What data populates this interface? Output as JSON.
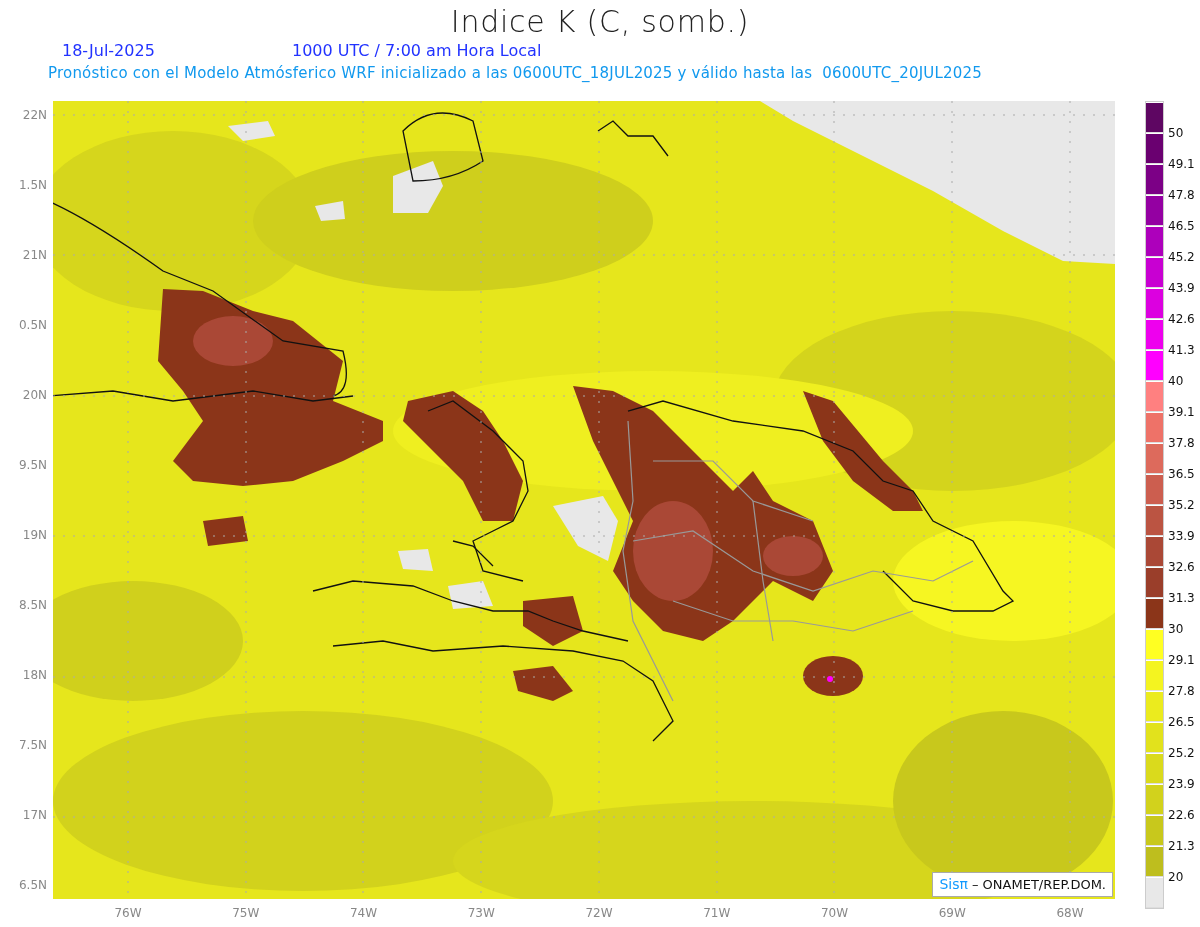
{
  "title": "Indice K (C, somb.)",
  "date": "18-Jul-2025",
  "time": "1000 UTC / 7:00 am Hora Local",
  "subtitle": "Pronóstico con el Modelo Atmósferico WRF inicializado a las 0600UTC_18JUL2025 y válido hasta las  0600UTC_20JUL2025",
  "map": {
    "lat_labels": [
      "22N",
      "1.5N",
      "21N",
      "0.5N",
      "20N",
      "9.5N",
      "19N",
      "8.5N",
      "18N",
      "7.5N",
      "17N",
      "6.5N"
    ],
    "lon_labels": [
      "76W",
      "75W",
      "74W",
      "73W",
      "72W",
      "71W",
      "70W",
      "69W",
      "68W"
    ],
    "credit": {
      "logo": "Sisπ",
      "text": "– ONAMET/REP.DOM."
    }
  },
  "legend": [
    {
      "color": "#5e0662",
      "label": "50"
    },
    {
      "color": "#6a0070",
      "label": "49.1"
    },
    {
      "color": "#7c0086",
      "label": "47.8"
    },
    {
      "color": "#9400a2",
      "label": "46.5"
    },
    {
      "color": "#ad00bb",
      "label": "45.2"
    },
    {
      "color": "#c800d2",
      "label": "43.9"
    },
    {
      "color": "#dc00e0",
      "label": "42.6"
    },
    {
      "color": "#ee00ee",
      "label": "41.3"
    },
    {
      "color": "#ff00ff",
      "label": "40"
    },
    {
      "color": "#ff8080",
      "label": "39.1"
    },
    {
      "color": "#ee7268",
      "label": "37.8"
    },
    {
      "color": "#dd6a5c",
      "label": "36.5"
    },
    {
      "color": "#cc5e4f",
      "label": "35.2"
    },
    {
      "color": "#bb5442",
      "label": "33.9"
    },
    {
      "color": "#aa4836",
      "label": "32.6"
    },
    {
      "color": "#9a3e2a",
      "label": "31.3"
    },
    {
      "color": "#8b3519",
      "label": "30"
    },
    {
      "color": "#ffff22",
      "label": "29.1"
    },
    {
      "color": "#f4f420",
      "label": "27.8"
    },
    {
      "color": "#ebeb1e",
      "label": "26.5"
    },
    {
      "color": "#e2e21c",
      "label": "25.2"
    },
    {
      "color": "#dada1c",
      "label": "23.9"
    },
    {
      "color": "#d2d21c",
      "label": "22.6"
    },
    {
      "color": "#c8c81c",
      "label": "21.3"
    },
    {
      "color": "#bebe1e",
      "label": "20"
    },
    {
      "color": "#e8e8e8"
    }
  ]
}
